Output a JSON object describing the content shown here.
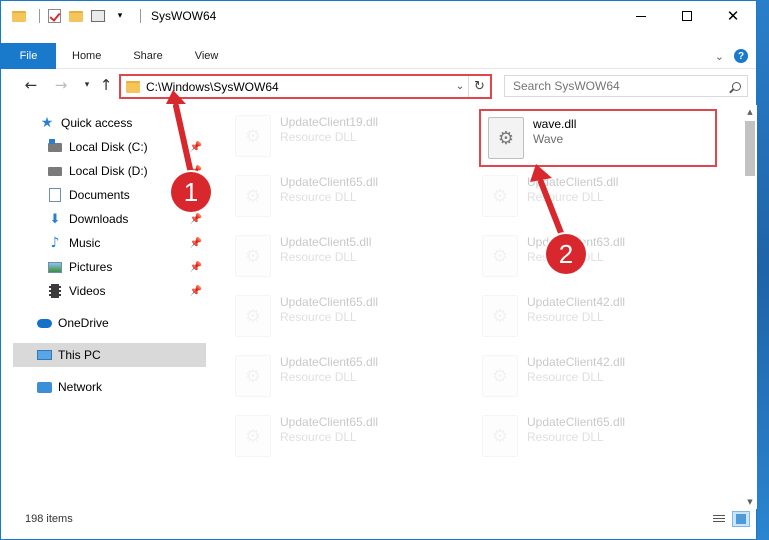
{
  "window": {
    "title": "SysWOW64",
    "colors": {
      "accent": "#1979ca",
      "highlight": "#e0474c",
      "badge": "#d8272d"
    }
  },
  "caption": {
    "minimize_icon": "minimize-icon",
    "maximize_icon": "maximize-icon",
    "close": "✕"
  },
  "ribbon": {
    "tabs": [
      "File",
      "Home",
      "Share",
      "View"
    ],
    "help": "?"
  },
  "address": {
    "path": "C:\\Windows\\SysWOW64",
    "refresh": "↻",
    "dropdown": "⌄"
  },
  "search": {
    "placeholder": "Search SysWOW64"
  },
  "nav": {
    "items": [
      {
        "label": "Quick access",
        "icon": "star-icon",
        "pinned": false
      },
      {
        "label": "Local Disk (C:)",
        "icon": "drive-icon",
        "pinned": true
      },
      {
        "label": "Local Disk (D:)",
        "icon": "drive-icon",
        "pinned": true
      },
      {
        "label": "Documents",
        "icon": "documents-icon",
        "pinned": true
      },
      {
        "label": "Downloads",
        "icon": "downloads-icon",
        "pinned": true
      },
      {
        "label": "Music",
        "icon": "music-icon",
        "pinned": true
      },
      {
        "label": "Pictures",
        "icon": "pictures-icon",
        "pinned": true
      },
      {
        "label": "Videos",
        "icon": "videos-icon",
        "pinned": true
      },
      {
        "label": "OneDrive",
        "icon": "onedrive-icon",
        "pinned": false
      },
      {
        "label": "This PC",
        "icon": "this-pc-icon",
        "pinned": false,
        "selected": true
      },
      {
        "label": "Network",
        "icon": "network-icon",
        "pinned": false
      }
    ]
  },
  "files": {
    "left": [
      {
        "name": "UpdateClient19.dll",
        "desc": "Resource DLL"
      },
      {
        "name": "UpdateClient65.dll",
        "desc": "Resource DLL"
      },
      {
        "name": "UpdateClient5.dll",
        "desc": "Resource DLL"
      },
      {
        "name": "UpdateClient65.dll",
        "desc": "Resource DLL"
      },
      {
        "name": "UpdateClient65.dll",
        "desc": "Resource DLL"
      },
      {
        "name": "UpdateClient65.dll",
        "desc": "Resource DLL"
      }
    ],
    "right": [
      {
        "name": "wave.dll",
        "desc": "Wave",
        "highlighted": true
      },
      {
        "name": "UpdateClient5.dll",
        "desc": "Resource DLL"
      },
      {
        "name": "UpdateClient63.dll",
        "desc": "Resource DLL"
      },
      {
        "name": "UpdateClient42.dll",
        "desc": "Resource DLL"
      },
      {
        "name": "UpdateClient42.dll",
        "desc": "Resource DLL"
      },
      {
        "name": "UpdateClient65.dll",
        "desc": "Resource DLL"
      }
    ]
  },
  "status": {
    "count": "198 items"
  },
  "annotations": {
    "badge1": "1",
    "badge2": "2"
  }
}
